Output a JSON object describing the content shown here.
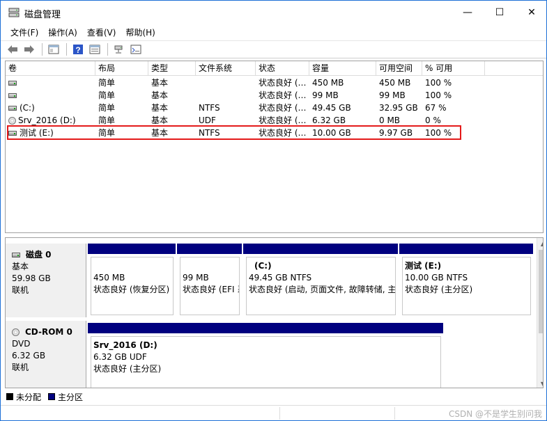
{
  "window": {
    "title": "磁盘管理",
    "minimize": "—",
    "maximize": "☐",
    "close": "✕"
  },
  "menu": [
    "文件(F)",
    "操作(A)",
    "查看(V)",
    "帮助(H)"
  ],
  "toolbar": [
    "back-arrow-icon",
    "forward-arrow-icon",
    "console-tree-icon",
    "help-icon",
    "properties-icon",
    "connect-icon",
    "disk-list-icon"
  ],
  "volume_table": {
    "columns": [
      "卷",
      "布局",
      "类型",
      "文件系统",
      "状态",
      "容量",
      "可用空间",
      "% 可用"
    ],
    "rows": [
      {
        "volume": "",
        "layout": "简单",
        "type": "基本",
        "fs": "",
        "status": "状态良好 (…",
        "capacity": "450 MB",
        "free": "450 MB",
        "pct": "100 %",
        "icon": "drive"
      },
      {
        "volume": "",
        "layout": "简单",
        "type": "基本",
        "fs": "",
        "status": "状态良好 (…",
        "capacity": "99 MB",
        "free": "99 MB",
        "pct": "100 %",
        "icon": "drive"
      },
      {
        "volume": "(C:)",
        "layout": "简单",
        "type": "基本",
        "fs": "NTFS",
        "status": "状态良好 (…",
        "capacity": "49.45 GB",
        "free": "32.95 GB",
        "pct": "67 %",
        "icon": "drive"
      },
      {
        "volume": "Srv_2016 (D:)",
        "layout": "简单",
        "type": "基本",
        "fs": "UDF",
        "status": "状态良好 (…",
        "capacity": "6.32 GB",
        "free": "0 MB",
        "pct": "0 %",
        "icon": "cd"
      },
      {
        "volume": "测试 (E:)",
        "layout": "简单",
        "type": "基本",
        "fs": "NTFS",
        "status": "状态良好 (…",
        "capacity": "10.00 GB",
        "free": "9.97 GB",
        "pct": "100 %",
        "icon": "drive"
      }
    ]
  },
  "disks": [
    {
      "name": "磁盘 0",
      "type": "基本",
      "size": "59.98 GB",
      "state": "联机",
      "partitions": [
        {
          "name": "",
          "size": "450 MB",
          "status": "状态良好 (恢复分区)"
        },
        {
          "name": "",
          "size": "99 MB",
          "status": "状态良好 (EFI 系"
        },
        {
          "name": "(C:)",
          "size": "49.45 GB NTFS",
          "status": "状态良好 (启动, 页面文件, 故障转储, 主"
        },
        {
          "name": "测试  (E:)",
          "size": "10.00 GB NTFS",
          "status": "状态良好 (主分区)"
        }
      ]
    },
    {
      "name": "CD-ROM 0",
      "type": "DVD",
      "size": "6.32 GB",
      "state": "联机",
      "partitions": [
        {
          "name": "Srv_2016  (D:)",
          "size": "6.32 GB UDF",
          "status": "状态良好 (主分区)"
        }
      ]
    }
  ],
  "legend": [
    {
      "label": "未分配",
      "color": "#000000"
    },
    {
      "label": "主分区",
      "color": "#00007f"
    }
  ],
  "watermark": "CSDN @不是学生别问我"
}
